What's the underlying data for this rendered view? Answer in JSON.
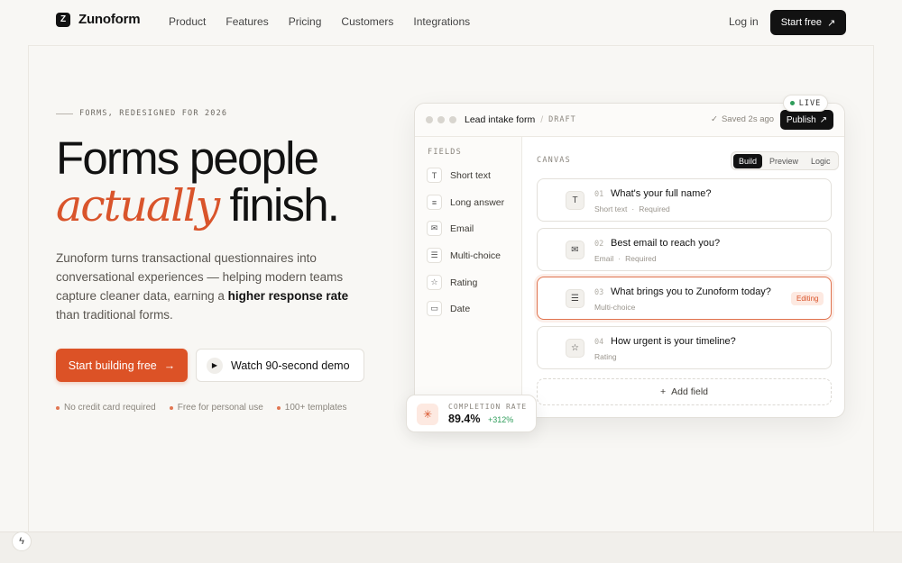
{
  "brand": {
    "name": "Zunoform",
    "mark": "Z"
  },
  "nav": {
    "links": [
      "Product",
      "Features",
      "Pricing",
      "Customers",
      "Integrations"
    ],
    "login": "Log in",
    "cta": "Start free"
  },
  "hero": {
    "eyebrow": "FORMS, REDESIGNED FOR 2026",
    "headline_line1": "Forms people",
    "headline_accent": "actually",
    "headline_rest": " finish.",
    "desc_part1": "Zunoform turns transactional questionnaires into conversational experiences — helping modern teams capture cleaner data, earning a ",
    "desc_strong": "higher response rate",
    "desc_part2": " than traditional forms.",
    "primary_cta": "Start building free",
    "secondary_cta": "Watch 90-second demo",
    "perks": [
      "No credit card required",
      "Free for personal use",
      "100+ templates"
    ]
  },
  "app": {
    "doc_title": "Lead intake form",
    "doc_status": "DRAFT",
    "saved": "Saved 2s ago",
    "publish": "Publish",
    "live": "LIVE",
    "fields_label": "FIELDS",
    "fields": [
      {
        "label": "Short text",
        "icon": "T"
      },
      {
        "label": "Long answer",
        "icon": "≡"
      },
      {
        "label": "Email",
        "icon": "✉"
      },
      {
        "label": "Multi-choice",
        "icon": "☰"
      },
      {
        "label": "Rating",
        "icon": "☆"
      },
      {
        "label": "Date",
        "icon": "▭"
      }
    ],
    "canvas_label": "CANVAS",
    "modes": [
      "Build",
      "Preview",
      "Logic"
    ],
    "active_mode": "Build",
    "questions": [
      {
        "num": "01",
        "text": "What's your full name?",
        "type": "Short text",
        "required": "Required",
        "icon": "T"
      },
      {
        "num": "02",
        "text": "Best email to reach you?",
        "type": "Email",
        "required": "Required",
        "icon": "✉"
      },
      {
        "num": "03",
        "text": "What brings you to Zunoform today?",
        "type": "Multi-choice",
        "required": "",
        "icon": "☰",
        "badge": "Editing"
      },
      {
        "num": "04",
        "text": "How urgent is your timeline?",
        "type": "Rating",
        "required": "",
        "icon": "☆"
      }
    ],
    "add_field": "Add field"
  },
  "completion": {
    "label": "COMPLETION RATE",
    "value": "89.4%",
    "delta": "+312%"
  }
}
